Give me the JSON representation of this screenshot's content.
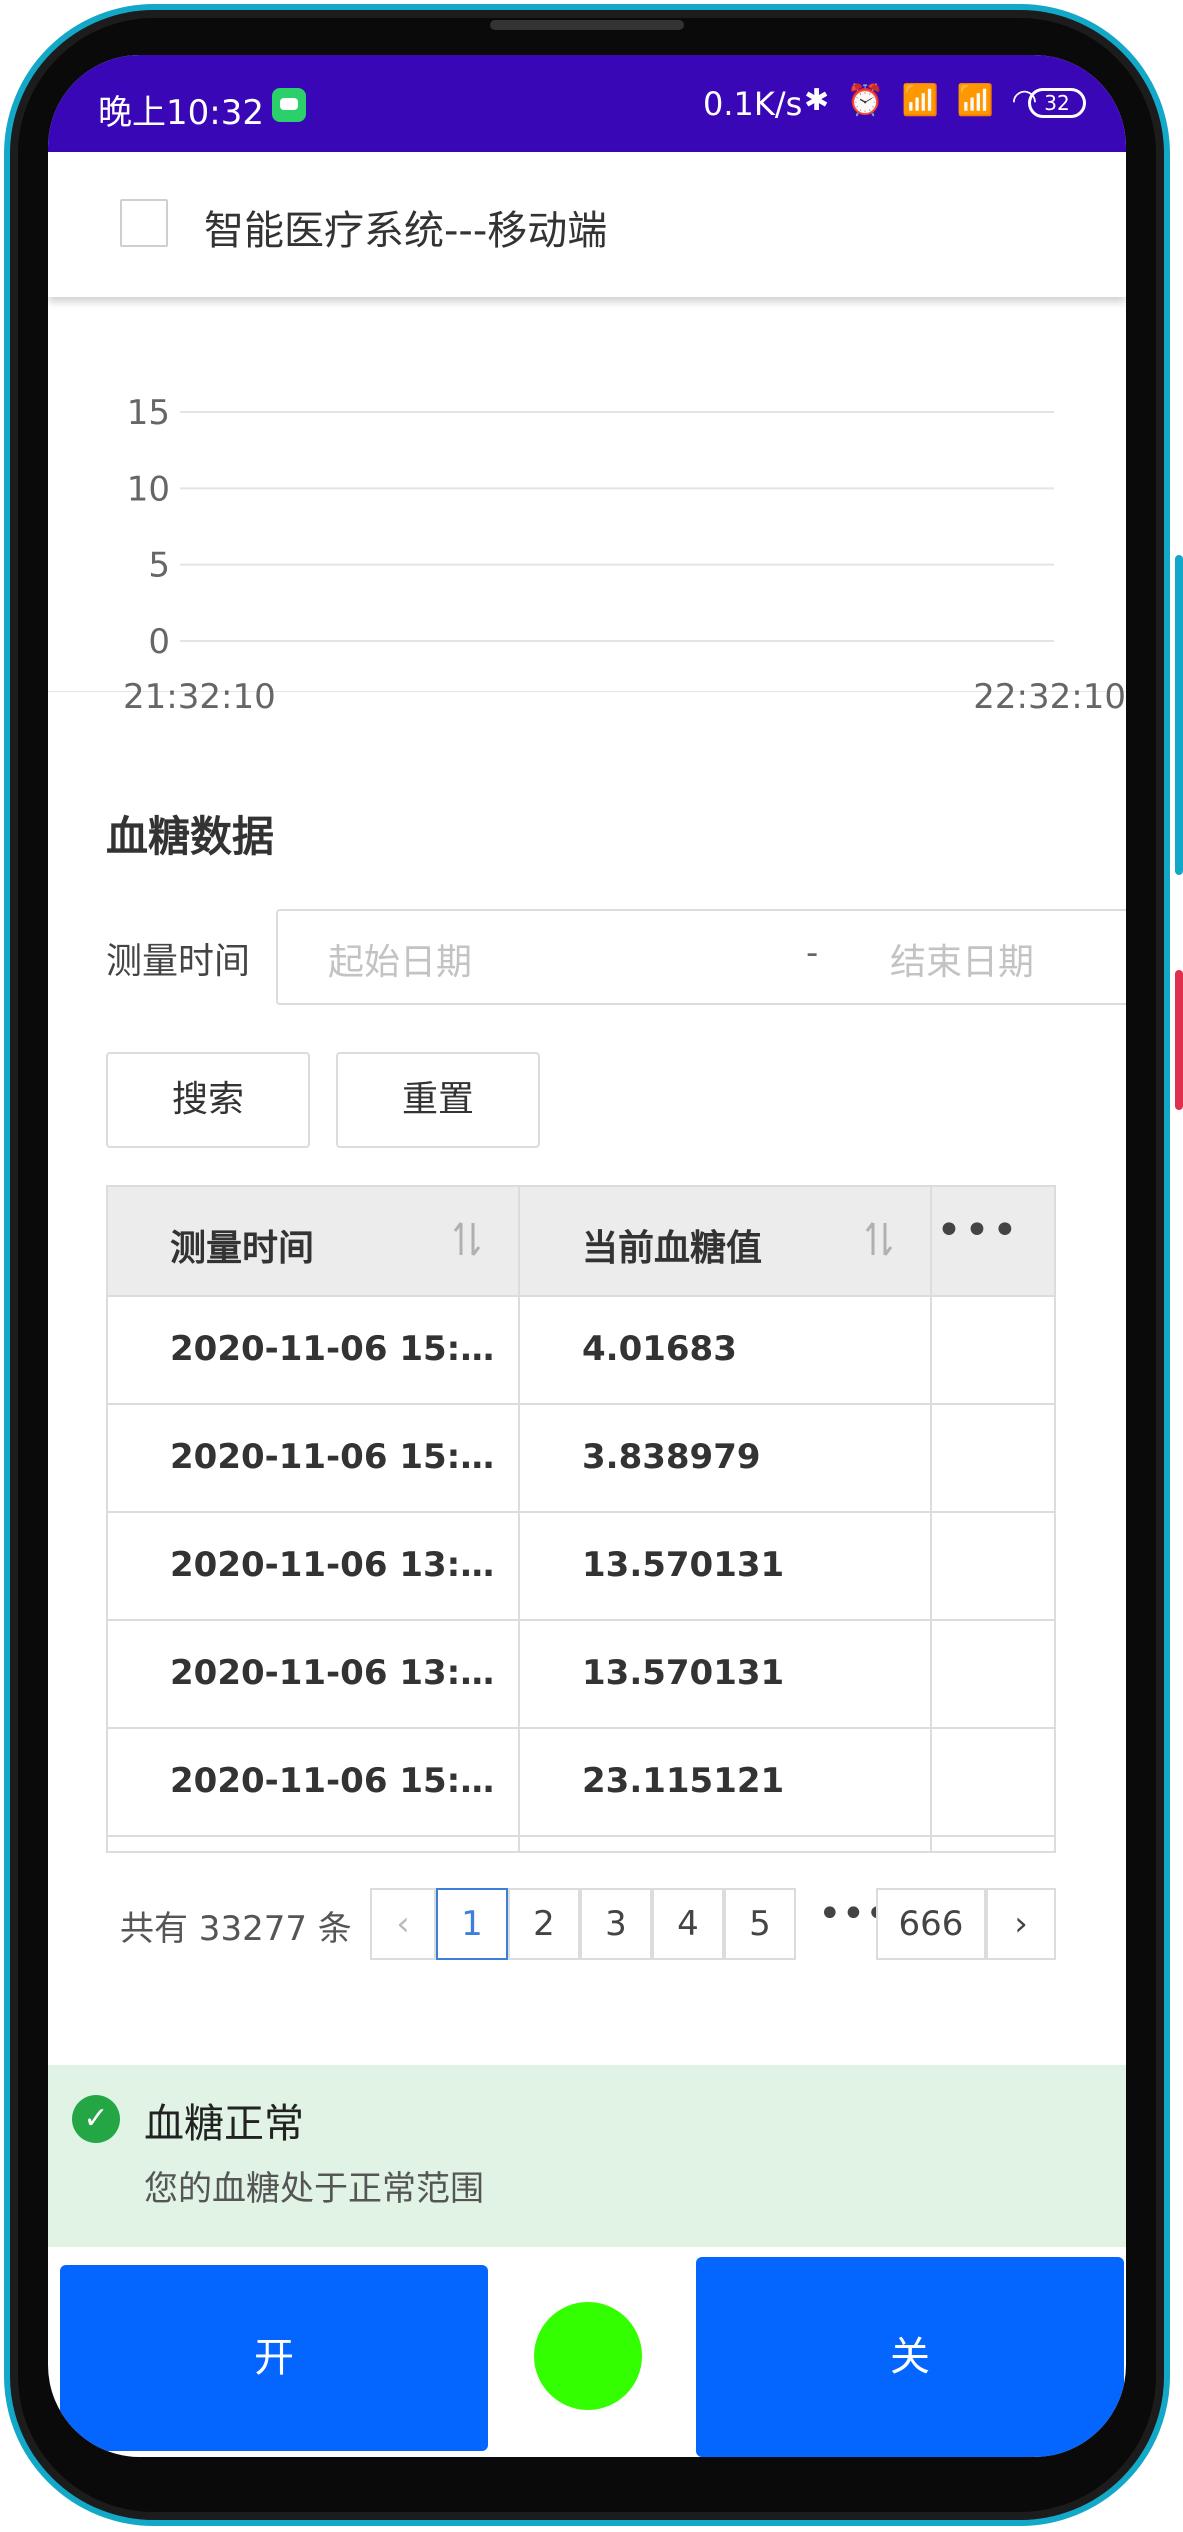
{
  "status_bar": {
    "time": "晚上10:32",
    "net_speed": "0.1K/s",
    "icons": "✱ ⏰ 📶 📶 ◠",
    "battery": "32"
  },
  "app_bar": {
    "title": "智能医疗系统---移动端"
  },
  "chart_data": {
    "type": "line",
    "x_ticks": [
      "21:32:10",
      "22:32:10"
    ],
    "y_ticks": [
      15,
      10,
      5,
      0
    ],
    "ylim": [
      0,
      15
    ],
    "series": [],
    "grid": true
  },
  "section": {
    "title": "血糖数据"
  },
  "filter": {
    "label": "测量时间",
    "start_placeholder": "起始日期",
    "separator": "-",
    "end_placeholder": "结束日期",
    "search_label": "搜索",
    "reset_label": "重置"
  },
  "table": {
    "headers": [
      "测量时间",
      "当前血糖值"
    ],
    "more_icon": "•••",
    "rows": [
      [
        "2020-11-06 15:…",
        "4.01683"
      ],
      [
        "2020-11-06 15:…",
        "3.838979"
      ],
      [
        "2020-11-06 13:…",
        "13.570131"
      ],
      [
        "2020-11-06 13:…",
        "13.570131"
      ],
      [
        "2020-11-06 15:…",
        "23.115121"
      ]
    ]
  },
  "pagination": {
    "total": "共有 33277 条",
    "prev": "‹",
    "pages": [
      "1",
      "2",
      "3",
      "4",
      "5"
    ],
    "dots": "•••",
    "last": "666",
    "next": "›",
    "current": "1"
  },
  "alert": {
    "title": "血糖正常",
    "description": "您的血糖处于正常范围",
    "icon": "✓",
    "color": "#25a645"
  },
  "controls": {
    "on_label": "开",
    "off_label": "关",
    "button_color": "#0466ff",
    "indicator_color": "#33ff00"
  }
}
